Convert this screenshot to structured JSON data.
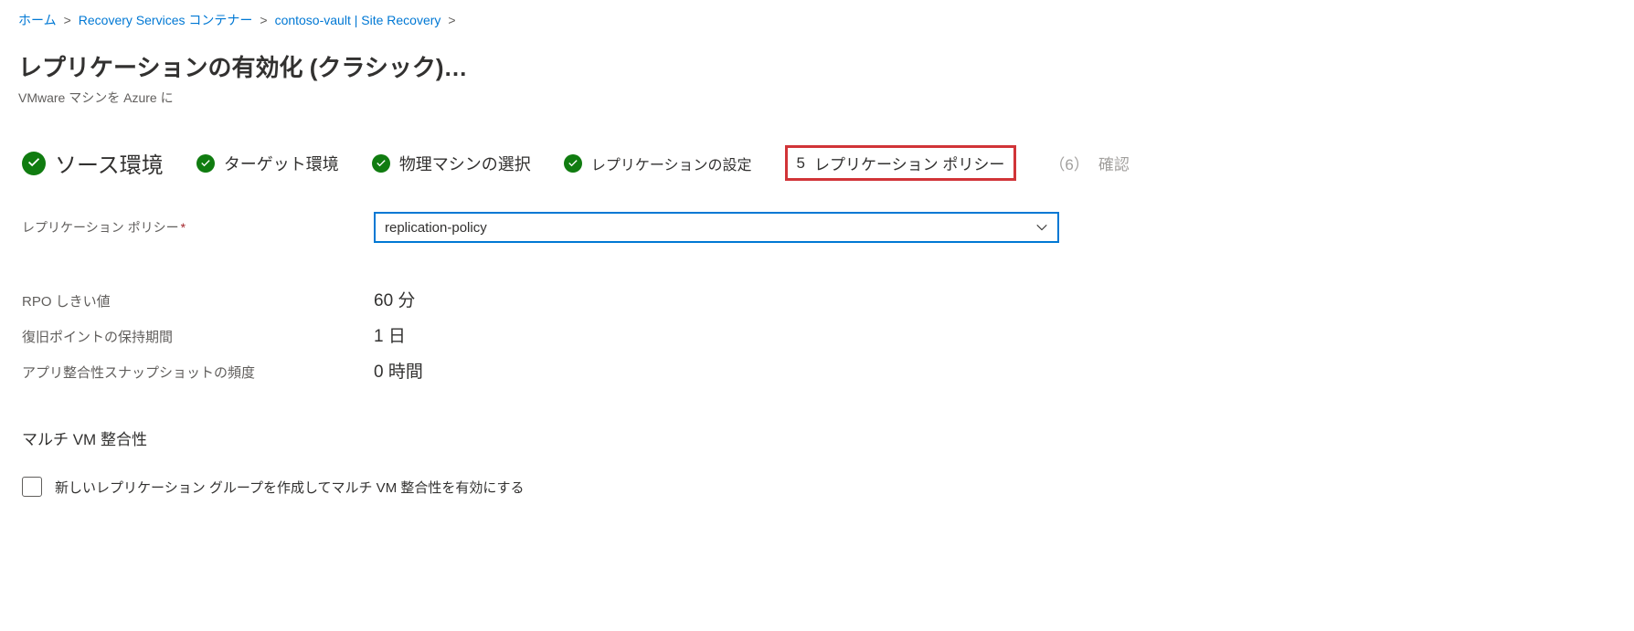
{
  "breadcrumb": {
    "home": "ホーム",
    "sep": ">",
    "rsv": "Recovery Services コンテナー",
    "vault": "contoso-vault | Site Recovery"
  },
  "page": {
    "title": "レプリケーションの有効化 (クラシック)…",
    "subtitle": "VMware マシンを Azure に"
  },
  "steps": {
    "s1": "ソース環境",
    "s2": "ターゲット環境",
    "s3": "物理マシンの選択",
    "s4": "レプリケーションの設定",
    "s5num": "5",
    "s5": "レプリケーション ポリシー",
    "s6num": "（6）",
    "s6": "確認"
  },
  "form": {
    "policy_label": "レプリケーション ポリシー",
    "policy_value": "replication-policy"
  },
  "details": {
    "rpo_label": "RPO しきい値",
    "rpo_value": "60 分",
    "retention_label": "復旧ポイントの保持期間",
    "retention_value": "1 日",
    "snapshot_label": "アプリ整合性スナップショットの頻度",
    "snapshot_value": "0 時間"
  },
  "multivm": {
    "heading": "マルチ VM 整合性",
    "checkbox_label": "新しいレプリケーション グループを作成してマルチ VM 整合性を有効にする"
  }
}
